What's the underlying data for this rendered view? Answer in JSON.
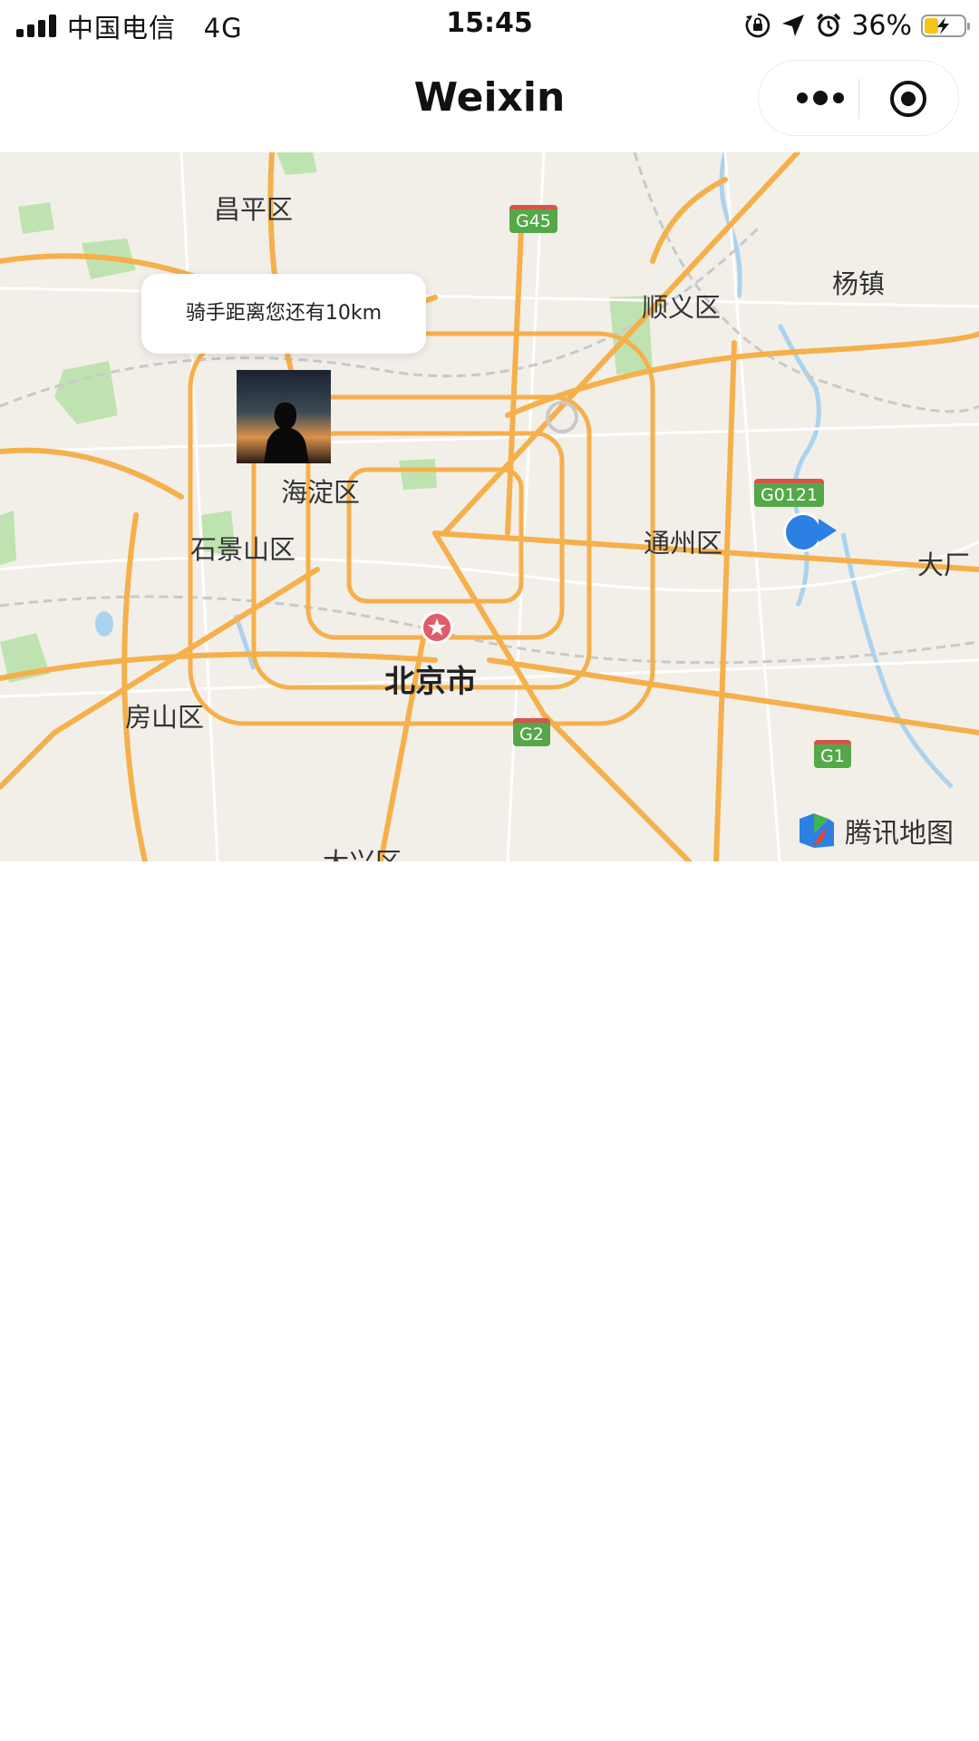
{
  "status_bar": {
    "carrier": "中国电信",
    "network": "4G",
    "time": "15:45",
    "battery_percent": "36%",
    "battery_level": 0.36,
    "icons": [
      "signal-icon",
      "orientation-lock-icon",
      "location-arrow-icon",
      "alarm-icon",
      "battery-charging-icon"
    ]
  },
  "nav": {
    "title": "Weixin",
    "more_icon": "more-dots-icon",
    "close_icon": "target-circle-icon"
  },
  "map": {
    "callout_text": "骑手距离您还有10km",
    "capital": "北京市",
    "districts": {
      "changping": "昌平区",
      "shunyi": "顺义区",
      "yangzhen": "杨镇",
      "haidian": "海淀区",
      "shijingshan": "石景山区",
      "tongzhou": "通州区",
      "dachang": "大厂",
      "fangshan": "房山区",
      "daxing": "大兴区"
    },
    "highways": {
      "g45": "G45",
      "g0121": "G0121",
      "g2": "G2",
      "g1": "G1"
    },
    "logo_text": "腾讯地图",
    "colors": {
      "road": "#f5b04c",
      "land": "#f2efe9",
      "park": "#bfe3b0",
      "water": "#aad3ef",
      "location": "#2c7fe3",
      "shield": "#55a848",
      "shield_top": "#d8544a"
    }
  }
}
